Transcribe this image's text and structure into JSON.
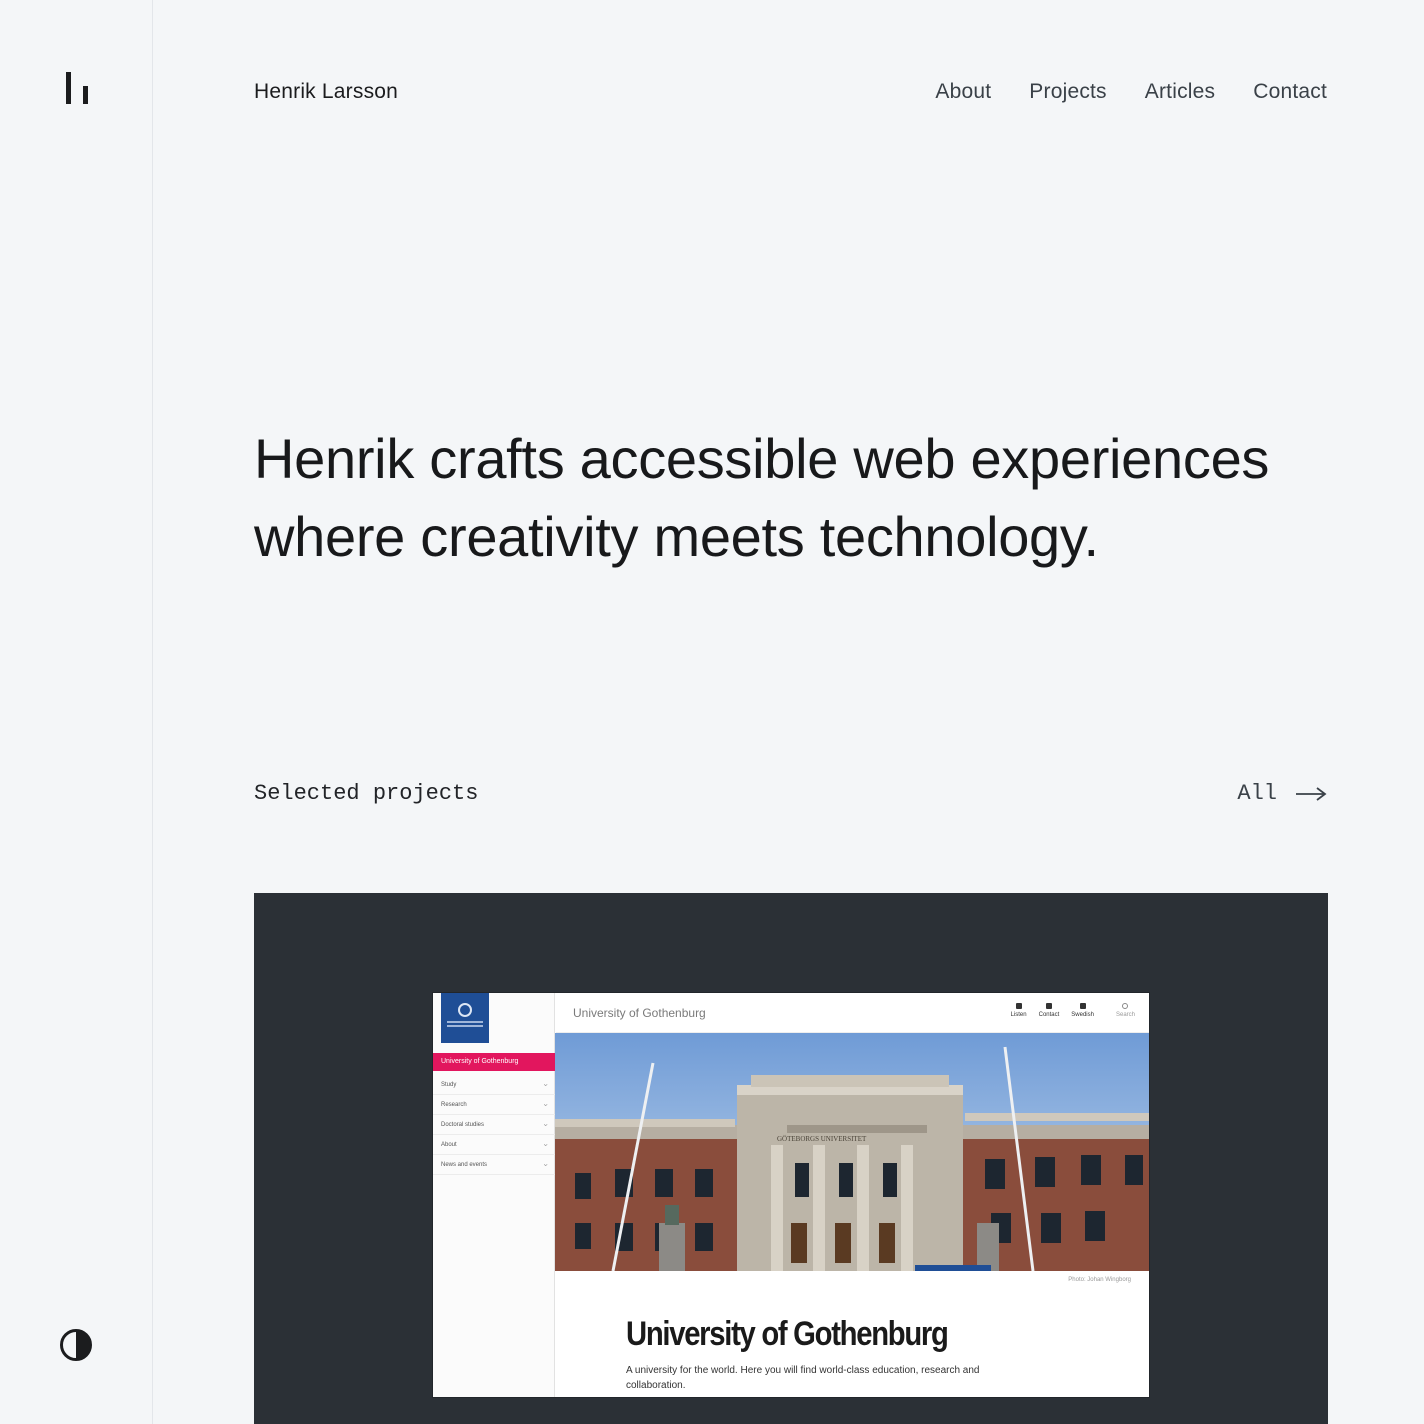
{
  "header": {
    "site_name": "Henrik Larsson",
    "nav": [
      "About",
      "Projects",
      "Articles",
      "Contact"
    ]
  },
  "hero": {
    "text": "Henrik crafts accessible web experiences where creativity meets technology."
  },
  "projects_section": {
    "title": "Selected projects",
    "all_link": "All"
  },
  "project_preview": {
    "site_title": "University of Gothenburg",
    "active_menu_item": "University of Gothenburg",
    "menu_items": [
      "Study",
      "Research",
      "Doctoral studies",
      "About",
      "News and events"
    ],
    "tools": [
      "Listen",
      "Contact",
      "Swedish",
      "Search"
    ],
    "building_inscription": "GÖTEBORGS UNIVERSITET",
    "photo_credit": "Photo: Johan Wingborg",
    "heading": "University of Gothenburg",
    "lede": "A university for the world. Here you will find world-class education, research and collaboration."
  },
  "icons": {
    "logo": "hl-logo-icon",
    "theme": "contrast-icon",
    "arrow": "arrow-right-icon"
  },
  "colors": {
    "background": "#f4f6f8",
    "text": "#1b1c1e",
    "card": "#2b3036",
    "accent_pink": "#e2165e",
    "uni_blue": "#1f4e96"
  }
}
